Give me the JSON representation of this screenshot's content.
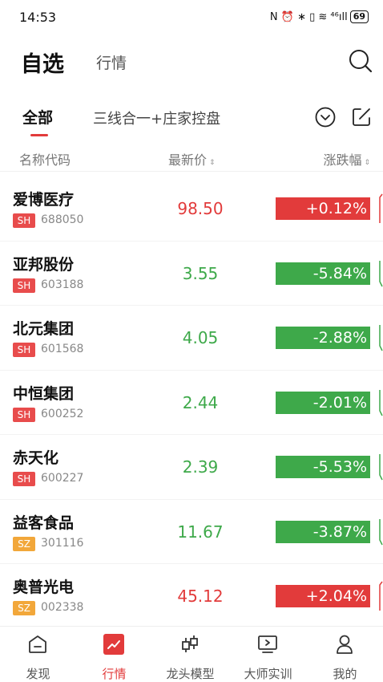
{
  "status_bar": {
    "time": "14:53",
    "icons": "N ⏰ ∗ ▯ ≋ ⁴⁶ıll",
    "battery": "69"
  },
  "header": {
    "title": "自选",
    "subtitle": "行情"
  },
  "groups": {
    "all": "全部",
    "other": "三线合一+庄家控盘"
  },
  "columns": {
    "name": "名称代码",
    "price": "最新价",
    "change": "涨跌幅",
    "sort_mark": "⇕"
  },
  "colors": {
    "red": "#e23b3b",
    "green": "#3ea94a",
    "sh_badge": "#e84c4c",
    "sz_badge": "#f2a73a"
  },
  "stocks": [
    {
      "name": "爱博医疗",
      "market": "SH",
      "code": "688050",
      "price": "98.50",
      "change": "+0.12%",
      "direction": "up"
    },
    {
      "name": "亚邦股份",
      "market": "SH",
      "code": "603188",
      "price": "3.55",
      "change": "-5.84%",
      "direction": "down"
    },
    {
      "name": "北元集团",
      "market": "SH",
      "code": "601568",
      "price": "4.05",
      "change": "-2.88%",
      "direction": "down"
    },
    {
      "name": "中恒集团",
      "market": "SH",
      "code": "600252",
      "price": "2.44",
      "change": "-2.01%",
      "direction": "down"
    },
    {
      "name": "赤天化",
      "market": "SH",
      "code": "600227",
      "price": "2.39",
      "change": "-5.53%",
      "direction": "down"
    },
    {
      "name": "益客食品",
      "market": "SZ",
      "code": "301116",
      "price": "11.67",
      "change": "-3.87%",
      "direction": "down"
    },
    {
      "name": "奥普光电",
      "market": "SZ",
      "code": "002338",
      "price": "45.12",
      "change": "+2.04%",
      "direction": "up"
    }
  ],
  "tabbar": {
    "items": [
      {
        "label": "发现",
        "icon": "home-icon"
      },
      {
        "label": "行情",
        "icon": "chart-trend-icon"
      },
      {
        "label": "龙头模型",
        "icon": "candlestick-icon"
      },
      {
        "label": "大师实训",
        "icon": "play-screen-icon"
      },
      {
        "label": "我的",
        "icon": "person-icon"
      }
    ],
    "active": "行情"
  }
}
